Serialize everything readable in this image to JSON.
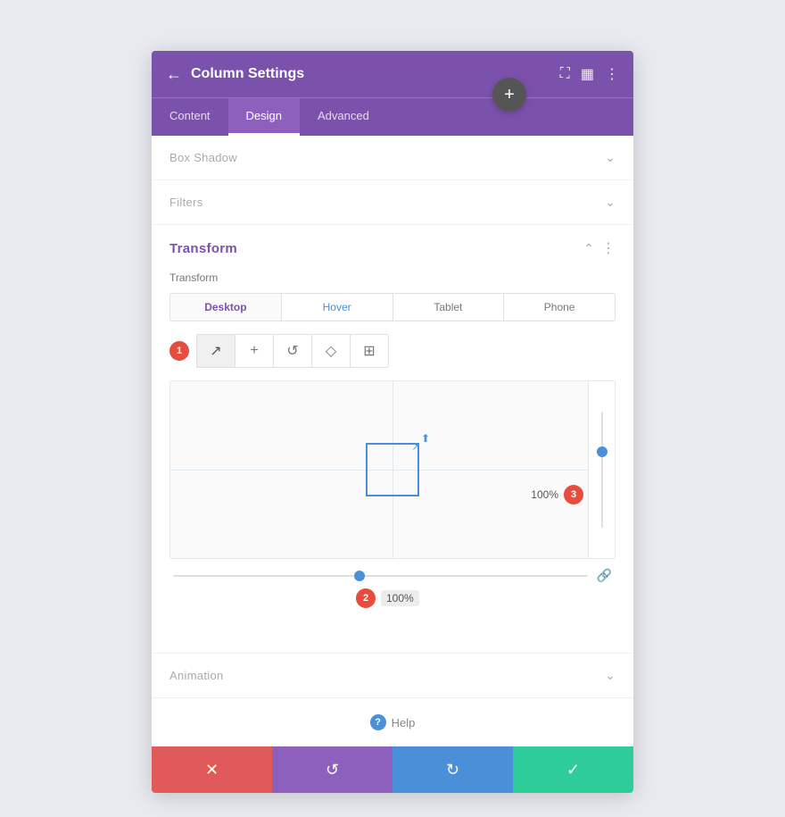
{
  "header": {
    "title": "Column Settings",
    "back_icon": "←",
    "expand_icon": "⛶",
    "columns_icon": "▦",
    "more_icon": "⋮"
  },
  "tabs": [
    {
      "label": "Content",
      "active": false
    },
    {
      "label": "Design",
      "active": true
    },
    {
      "label": "Advanced",
      "active": false
    }
  ],
  "sections": {
    "box_shadow": {
      "label": "Box Shadow"
    },
    "filters": {
      "label": "Filters"
    },
    "transform": {
      "label": "Transform"
    },
    "animation": {
      "label": "Animation"
    }
  },
  "transform": {
    "label": "Transform",
    "device_tabs": [
      {
        "label": "Desktop",
        "active": true
      },
      {
        "label": "Hover",
        "active": false,
        "hover": true
      },
      {
        "label": "Tablet",
        "active": false
      },
      {
        "label": "Phone",
        "active": false
      }
    ],
    "tools": [
      {
        "icon": "↗",
        "label": "scale"
      },
      {
        "icon": "+",
        "label": "translate"
      },
      {
        "icon": "↺",
        "label": "rotate"
      },
      {
        "icon": "◇",
        "label": "skew"
      },
      {
        "icon": "⊞",
        "label": "origin"
      }
    ],
    "h_value": "100%",
    "v_value": "100%",
    "badge1": "1",
    "badge2": "2",
    "badge3": "3"
  },
  "footer": {
    "cancel_icon": "✕",
    "undo_icon": "↺",
    "redo_icon": "↻",
    "save_icon": "✓"
  },
  "help": {
    "label": "Help"
  },
  "plus_btn": "+"
}
